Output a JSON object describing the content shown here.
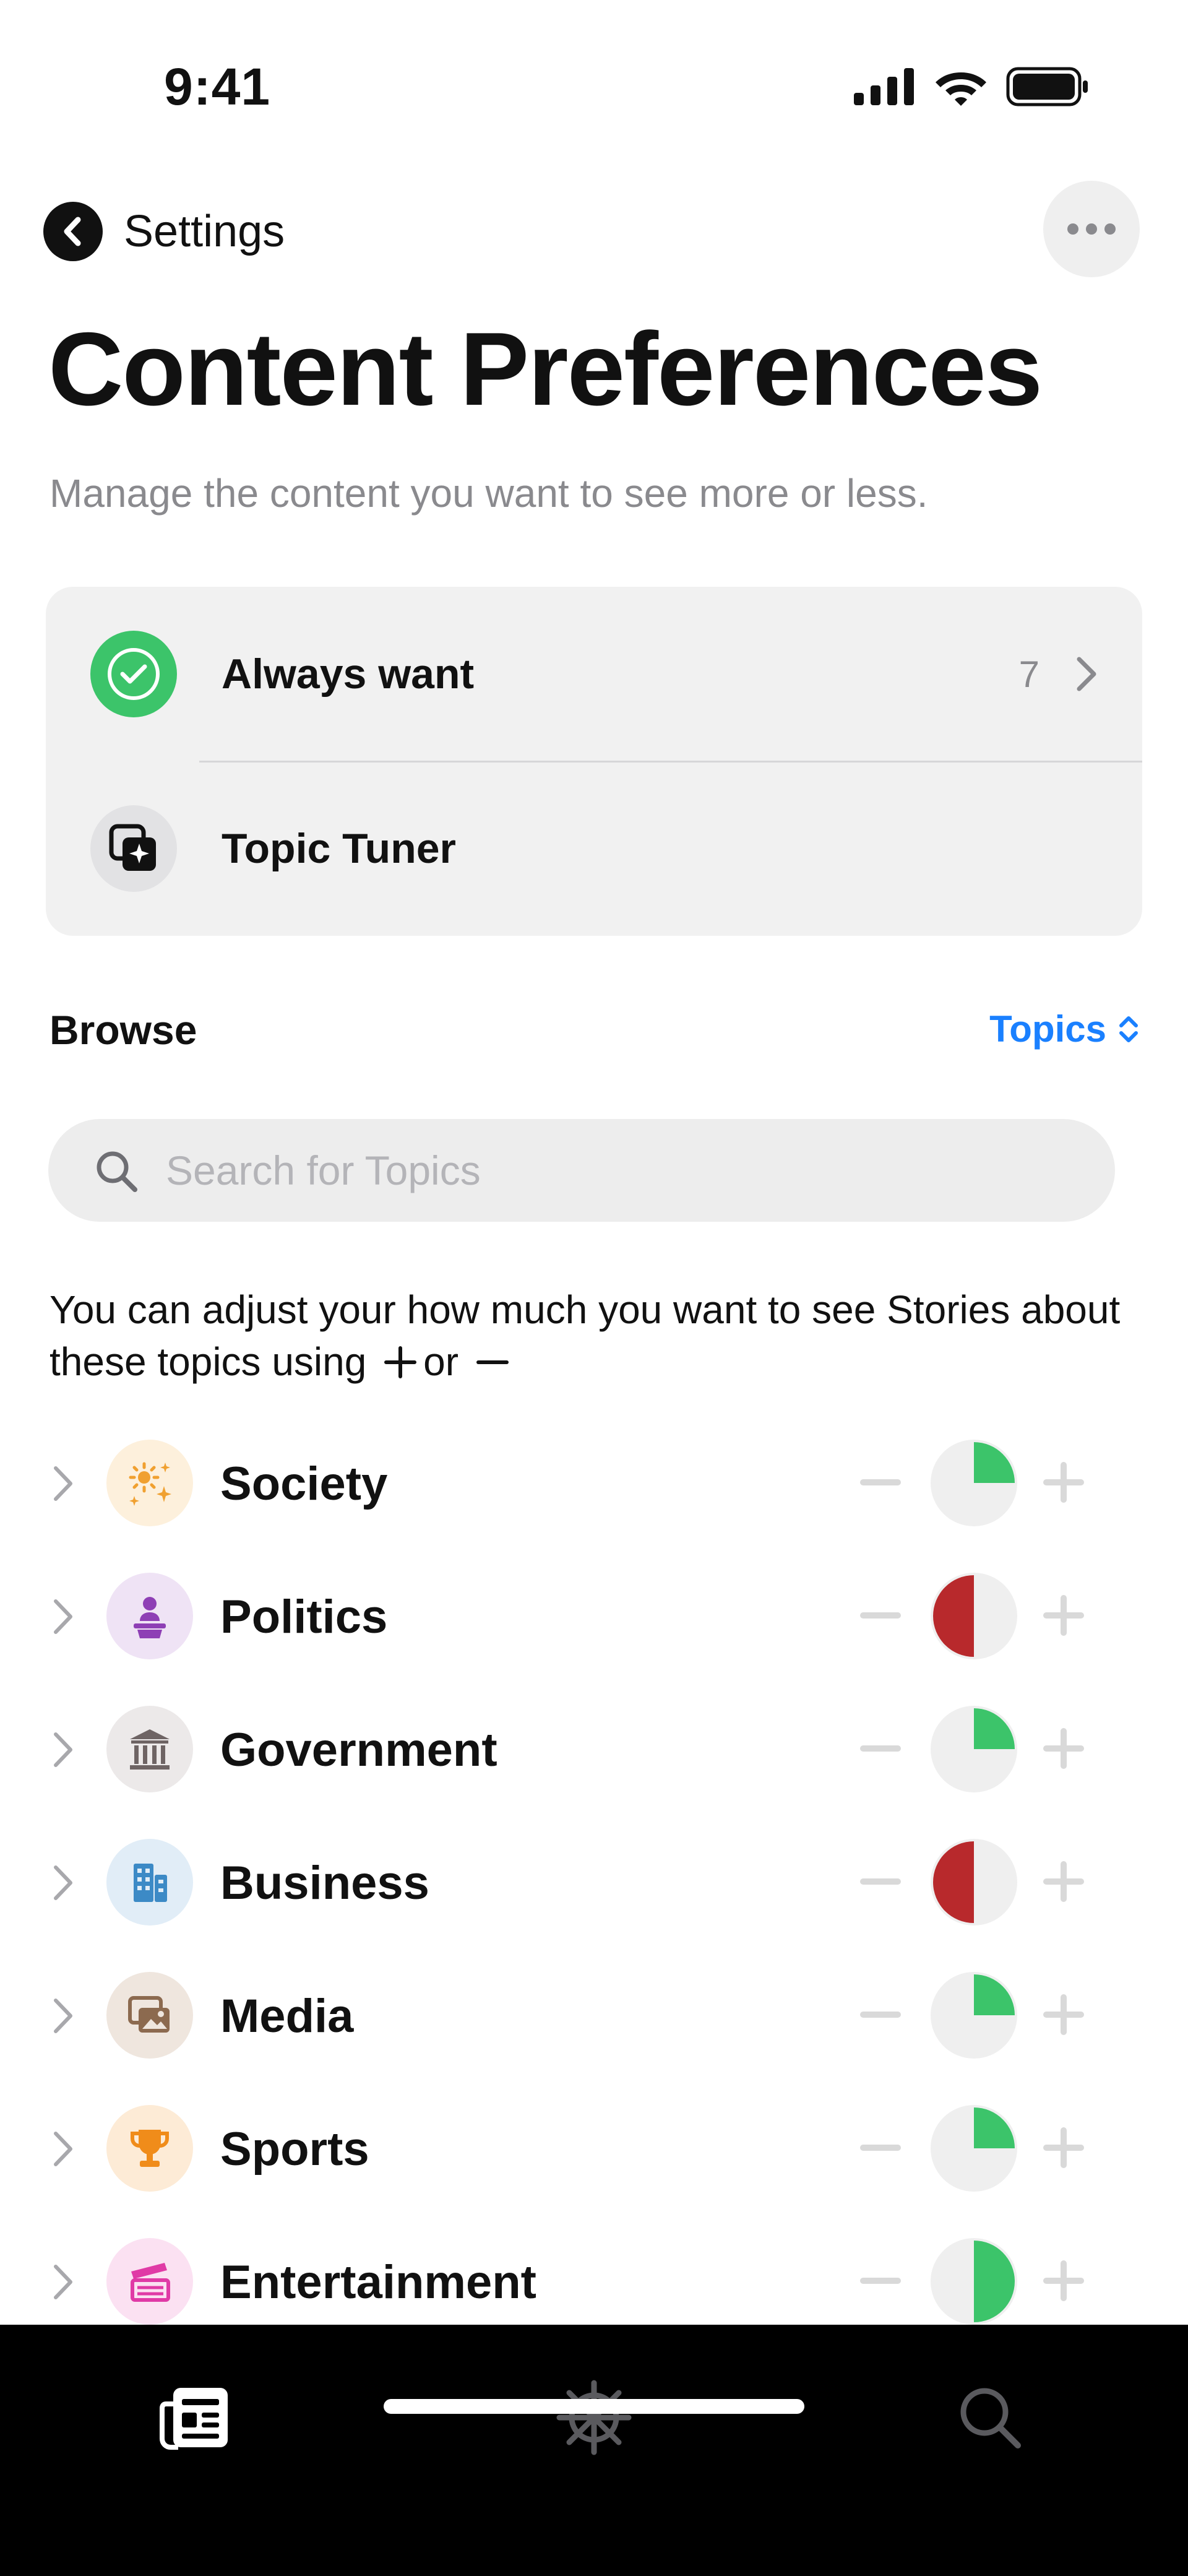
{
  "status_bar": {
    "time": "9:41"
  },
  "nav": {
    "back_label": "Settings"
  },
  "page": {
    "title": "Content Preferences",
    "subtitle": "Manage the content you want to see more or less."
  },
  "card": {
    "rows": [
      {
        "label": "Always want",
        "count": "7",
        "icon": "checkmark-circle-icon",
        "icon_color": "#3cc46a"
      },
      {
        "label": "Topic Tuner",
        "icon": "topic-tuner-icon"
      }
    ]
  },
  "browse": {
    "label": "Browse",
    "selector_label": "Topics",
    "accent_color": "#1a80ff"
  },
  "search": {
    "placeholder": "Search for Topics"
  },
  "hint": {
    "text_before": "You can adjust your how much you want to see Stories about these topics using",
    "connector": "or"
  },
  "topics": [
    {
      "name": "Society",
      "icon": "sparkles-icon",
      "icon_bg": "#fdf0dc",
      "icon_color": "#f0a030",
      "level": 0.25,
      "level_color": "#3cc46a"
    },
    {
      "name": "Politics",
      "icon": "person-podium-icon",
      "icon_bg": "#efe3f5",
      "icon_color": "#8e3fb5",
      "level": -0.5,
      "level_color": "#b8292c"
    },
    {
      "name": "Government",
      "icon": "building-columns-icon",
      "icon_bg": "#ece9e9",
      "icon_color": "#6e6464",
      "level": 0.25,
      "level_color": "#3cc46a"
    },
    {
      "name": "Business",
      "icon": "office-building-icon",
      "icon_bg": "#e1edf7",
      "icon_color": "#3c8ac6",
      "level": -0.5,
      "level_color": "#b8292c"
    },
    {
      "name": "Media",
      "icon": "photos-icon",
      "icon_bg": "#efe6de",
      "icon_color": "#8c6a4f",
      "level": 0.25,
      "level_color": "#3cc46a"
    },
    {
      "name": "Sports",
      "icon": "trophy-icon",
      "icon_bg": "#fdebd6",
      "icon_color": "#f08c1a",
      "level": 0.25,
      "level_color": "#3cc46a"
    },
    {
      "name": "Entertainment",
      "icon": "clapperboard-icon",
      "icon_bg": "#fbe1f2",
      "icon_color": "#e03aa6",
      "level": 0.5,
      "level_color": "#3cc46a"
    }
  ],
  "tab_bar": {
    "tabs": [
      {
        "name": "news-tab",
        "icon": "newspaper-icon",
        "active": true
      },
      {
        "name": "sports-tab",
        "icon": "ship-wheel-icon",
        "active": false
      },
      {
        "name": "search-tab",
        "icon": "search-icon",
        "active": false
      }
    ]
  }
}
